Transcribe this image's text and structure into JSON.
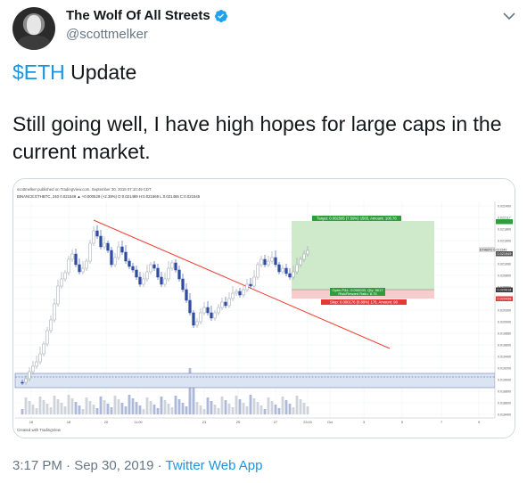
{
  "tweet": {
    "display_name": "The Wolf Of All Streets",
    "handle": "@scottmelker",
    "text_line1_cashtag": "$ETH",
    "text_line1_rest": " Update",
    "text_line2": "Still going well, I have high hopes for large caps in the current market.",
    "timestamp": "3:17 PM · Sep 30, 2019",
    "separator": " · ",
    "source": "Twitter Web App",
    "icons": {
      "verified": "verified-badge-icon",
      "menu": "chevron-down-icon"
    },
    "colors": {
      "link": "#1b95e0",
      "verified": "#1da1f2",
      "muted": "#657786"
    }
  },
  "chart": {
    "header_line1": "scottmelker published on TradingView.com, September 30, 2019 07:10:49 CDT",
    "header_line2": "BINANCE:ETHBTC, 240  0.021549  ▲ +0.000529 (+2.39%)  O:0.021489  H:0.021569  L:0.021465  C:0.021545",
    "footer": "Created with  TradingView",
    "target_label": "Target: 0.002565 (7.59%) 1565, Amount: 106.76",
    "openpl_label": "Open P&L: 0.000033, Qty: 5617",
    "ratio_label": "Risk/Reward Ratio: 8.75",
    "stop_label": "Stop: 0.000176 (0.89%) 176, Amount: 90",
    "price_tag_current": "0.021549",
    "price_tag_symbol": "ETHBTC 0.021549",
    "price_tag_entry": "0.020618",
    "price_tag_stop": "0.020438",
    "x_ticks": [
      "16",
      "18",
      "20",
      "11:00",
      "23",
      "25",
      "27",
      "23:00",
      "Oct",
      "3",
      "5",
      "7",
      "9"
    ],
    "y_ticks": [
      "0.022400",
      "0.022117",
      "0.021860",
      "0.021600",
      "0.021300",
      "0.021060",
      "0.020800",
      "0.020600",
      "0.020400",
      "0.020300",
      "0.020000",
      "0.019880",
      "0.019600",
      "0.019400",
      "0.019200",
      "0.019000",
      "0.018800",
      "0.018600",
      "0.018400"
    ]
  },
  "chart_data": {
    "type": "candlestick",
    "symbol": "BINANCE:ETHBTC",
    "timeframe": "240",
    "x_range": [
      "16",
      "9"
    ],
    "ylim": [
      0.0184,
      0.0224
    ],
    "position": {
      "entry": 0.020618,
      "target": 0.022117,
      "stop": 0.020438
    },
    "trendline": "descending",
    "support_zone": [
      0.0186,
      0.0188
    ],
    "volume": true
  }
}
